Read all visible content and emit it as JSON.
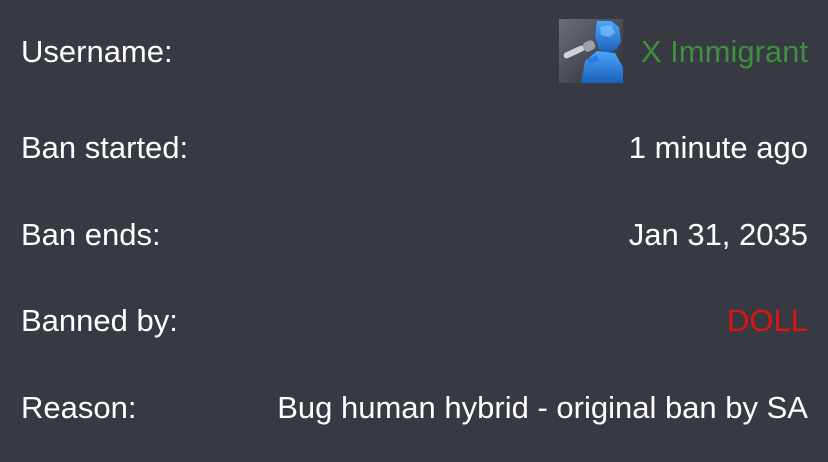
{
  "ban": {
    "username": {
      "label": "Username:",
      "value": "X Immigrant",
      "value_color": "#3f8f3f",
      "avatar_icon": "user-avatar-icon"
    },
    "started": {
      "label": "Ban started:",
      "value": "1 minute ago"
    },
    "ends": {
      "label": "Ban ends:",
      "value": "Jan 31, 2035"
    },
    "banned_by": {
      "label": "Banned by:",
      "value": "DOLL",
      "value_color": "#e0140f"
    },
    "reason": {
      "label": "Reason:",
      "value": "Bug human hybrid - original ban by SA"
    }
  },
  "colors": {
    "background": "#373a42",
    "text": "#ffffff"
  }
}
